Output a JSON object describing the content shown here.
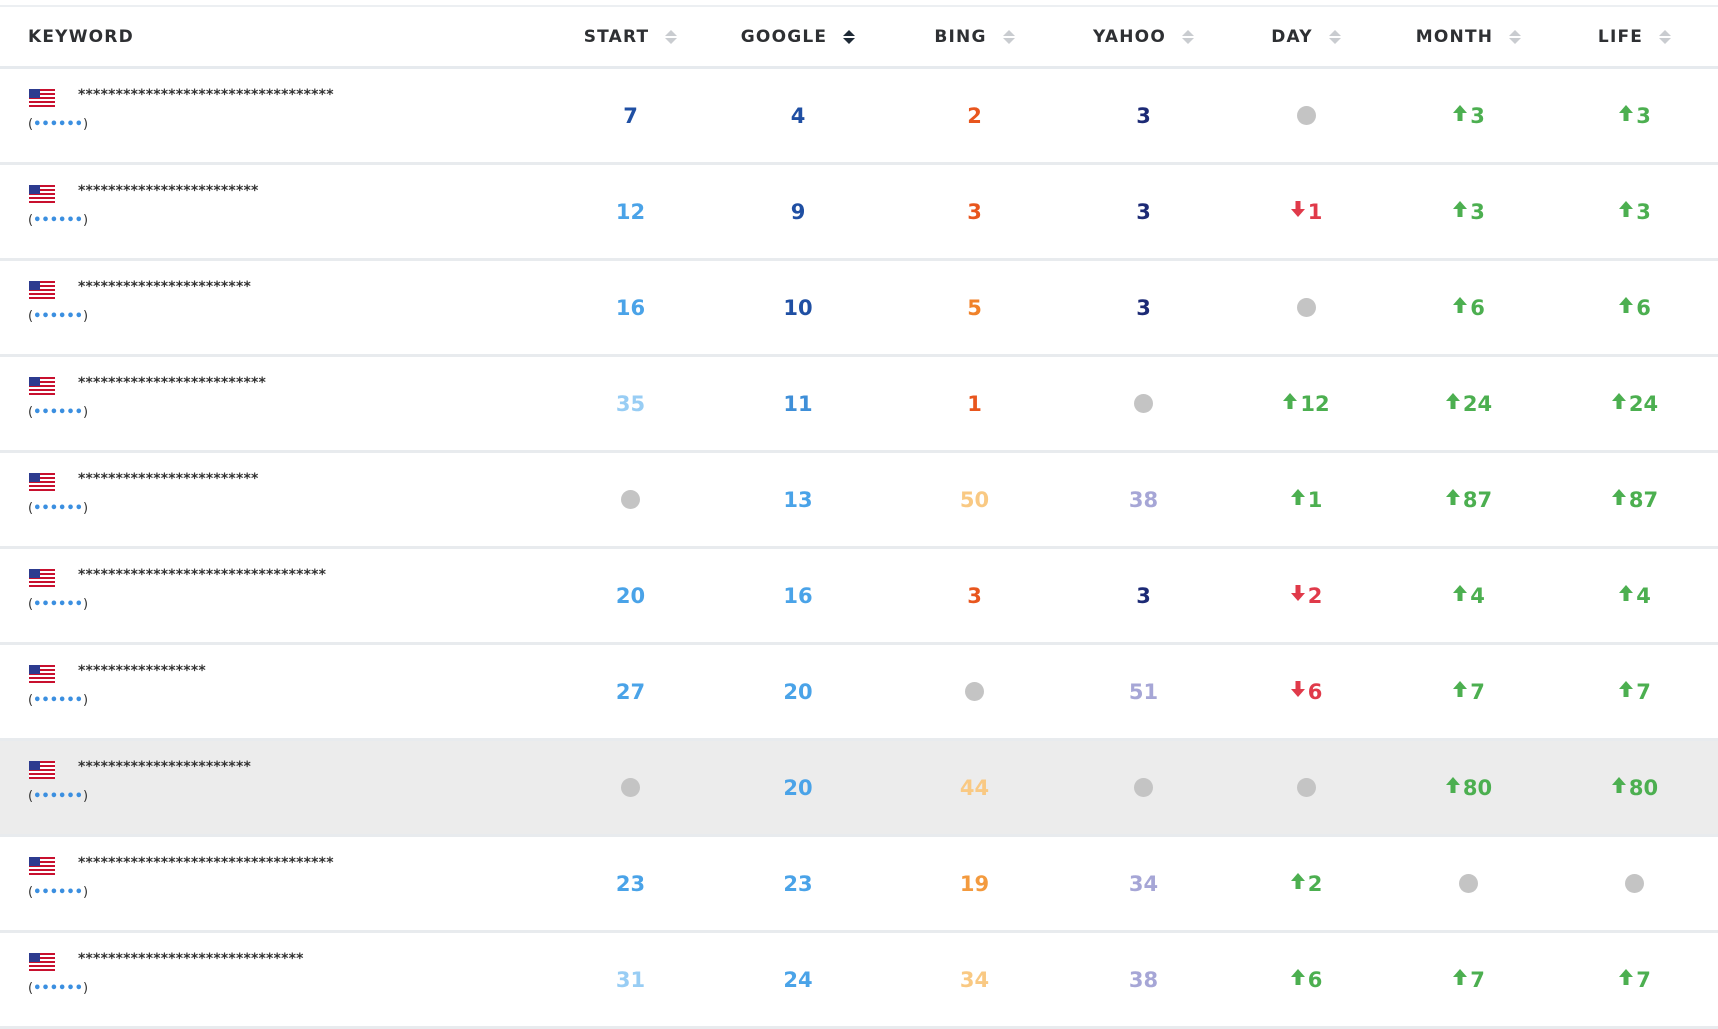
{
  "headers": {
    "keyword": "KEYWORD",
    "start": "START",
    "google": "GOOGLE",
    "bing": "BING",
    "yahoo": "YAHOO",
    "day": "DAY",
    "month": "MONTH",
    "life": "LIFE"
  },
  "active_sort": "google",
  "colors": {
    "green": "#4caf50",
    "red": "#e03a4a",
    "null_dot": "#c4c4c4",
    "row_highlight": "#ececec"
  },
  "rows": [
    {
      "keyword": "**********************************",
      "sub_open": "(",
      "sub_link": "••••••",
      "sub_close": ")",
      "start": {
        "v": "7",
        "c": "#1f4fa3"
      },
      "google": {
        "v": "4",
        "c": "#1f4fa3"
      },
      "bing": {
        "v": "2",
        "c": "#e8561e"
      },
      "yahoo": {
        "v": "3",
        "c": "#1c2a75"
      },
      "day": null,
      "month": {
        "dir": "up",
        "v": "3"
      },
      "life": {
        "dir": "up",
        "v": "3"
      }
    },
    {
      "keyword": "************************",
      "sub_open": "(",
      "sub_link": "••••••",
      "sub_close": ")",
      "start": {
        "v": "12",
        "c": "#4aa3e8"
      },
      "google": {
        "v": "9",
        "c": "#1f4fa3"
      },
      "bing": {
        "v": "3",
        "c": "#e8561e"
      },
      "yahoo": {
        "v": "3",
        "c": "#1c2a75"
      },
      "day": {
        "dir": "down",
        "v": "1"
      },
      "month": {
        "dir": "up",
        "v": "3"
      },
      "life": {
        "dir": "up",
        "v": "3"
      }
    },
    {
      "keyword": "***********************",
      "sub_open": "(",
      "sub_link": "••••••",
      "sub_close": ")",
      "start": {
        "v": "16",
        "c": "#4aa3e8"
      },
      "google": {
        "v": "10",
        "c": "#1f4fa3"
      },
      "bing": {
        "v": "5",
        "c": "#f0822a"
      },
      "yahoo": {
        "v": "3",
        "c": "#1c2a75"
      },
      "day": null,
      "month": {
        "dir": "up",
        "v": "6"
      },
      "life": {
        "dir": "up",
        "v": "6"
      }
    },
    {
      "keyword": "*************************",
      "sub_open": "(",
      "sub_link": "••••••",
      "sub_close": ")",
      "start": {
        "v": "35",
        "c": "#98cdf4"
      },
      "google": {
        "v": "11",
        "c": "#3f8fd8"
      },
      "bing": {
        "v": "1",
        "c": "#e8561e"
      },
      "yahoo": null,
      "day": {
        "dir": "up",
        "v": "12"
      },
      "month": {
        "dir": "up",
        "v": "24"
      },
      "life": {
        "dir": "up",
        "v": "24"
      }
    },
    {
      "keyword": "************************",
      "sub_open": "(",
      "sub_link": "••••••",
      "sub_close": ")",
      "start": null,
      "google": {
        "v": "13",
        "c": "#4aa3e8"
      },
      "bing": {
        "v": "50",
        "c": "#f9c983"
      },
      "yahoo": {
        "v": "38",
        "c": "#a6a6d6"
      },
      "day": {
        "dir": "up",
        "v": "1"
      },
      "month": {
        "dir": "up",
        "v": "87"
      },
      "life": {
        "dir": "up",
        "v": "87"
      }
    },
    {
      "keyword": "*********************************",
      "sub_open": "(",
      "sub_link": "••••••",
      "sub_close": ")",
      "start": {
        "v": "20",
        "c": "#4aa3e8"
      },
      "google": {
        "v": "16",
        "c": "#4aa3e8"
      },
      "bing": {
        "v": "3",
        "c": "#e8561e"
      },
      "yahoo": {
        "v": "3",
        "c": "#1c2a75"
      },
      "day": {
        "dir": "down",
        "v": "2"
      },
      "month": {
        "dir": "up",
        "v": "4"
      },
      "life": {
        "dir": "up",
        "v": "4"
      }
    },
    {
      "keyword": "*****************",
      "sub_open": "(",
      "sub_link": "••••••",
      "sub_close": ")",
      "start": {
        "v": "27",
        "c": "#4aa3e8"
      },
      "google": {
        "v": "20",
        "c": "#4aa3e8"
      },
      "bing": null,
      "yahoo": {
        "v": "51",
        "c": "#a6a6d6"
      },
      "day": {
        "dir": "down",
        "v": "6"
      },
      "month": {
        "dir": "up",
        "v": "7"
      },
      "life": {
        "dir": "up",
        "v": "7"
      }
    },
    {
      "keyword": "***********************",
      "sub_open": "(",
      "sub_link": "••••••",
      "sub_close": ")",
      "highlight": true,
      "start": null,
      "google": {
        "v": "20",
        "c": "#4aa3e8"
      },
      "bing": {
        "v": "44",
        "c": "#f9c983"
      },
      "yahoo": null,
      "day": null,
      "month": {
        "dir": "up",
        "v": "80"
      },
      "life": {
        "dir": "up",
        "v": "80"
      }
    },
    {
      "keyword": "**********************************",
      "sub_open": "(",
      "sub_link": "••••••",
      "sub_close": ")",
      "start": {
        "v": "23",
        "c": "#4aa3e8"
      },
      "google": {
        "v": "23",
        "c": "#4aa3e8"
      },
      "bing": {
        "v": "19",
        "c": "#f39a3e"
      },
      "yahoo": {
        "v": "34",
        "c": "#a6a6d6"
      },
      "day": {
        "dir": "up",
        "v": "2"
      },
      "month": null,
      "life": null
    },
    {
      "keyword": "******************************",
      "sub_open": "(",
      "sub_link": "••••••",
      "sub_close": ")",
      "start": {
        "v": "31",
        "c": "#98cdf4"
      },
      "google": {
        "v": "24",
        "c": "#4aa3e8"
      },
      "bing": {
        "v": "34",
        "c": "#f9c983"
      },
      "yahoo": {
        "v": "38",
        "c": "#a6a6d6"
      },
      "day": {
        "dir": "up",
        "v": "6"
      },
      "month": {
        "dir": "up",
        "v": "7"
      },
      "life": {
        "dir": "up",
        "v": "7"
      }
    }
  ]
}
